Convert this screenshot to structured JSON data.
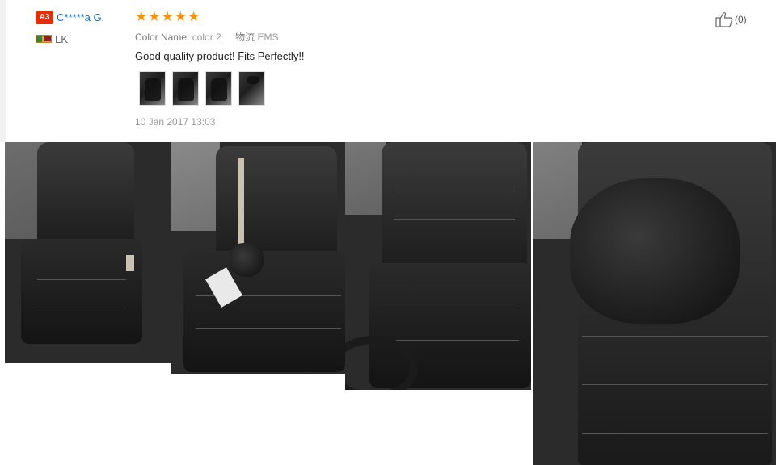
{
  "reviewer": {
    "level_badge": "A3",
    "name": "C*****a G.",
    "country_code": "LK"
  },
  "rating": {
    "stars": 5,
    "star_glyph": "★"
  },
  "attributes": {
    "color_label": "Color Name:",
    "color_value": "color 2",
    "logistics_label": "物流",
    "logistics_value": "EMS"
  },
  "review": {
    "text": "Good quality product! Fits Perfectly!!",
    "date": "10 Jan 2017 13:03"
  },
  "helpful": {
    "icon": "thumbs-up-icon",
    "count_text": "(0)"
  },
  "thumbnails": [
    "seat-photo-1",
    "seat-photo-2",
    "seat-photo-3",
    "seat-photo-4"
  ],
  "photos": [
    "front-seat-photo",
    "rear-seat-pillow-photo",
    "driver-seat-photo",
    "headrest-pillow-photo"
  ],
  "colors": {
    "accent_star": "#ff9000",
    "buyer_link": "#1a6ebd",
    "badge": "#e62e04"
  }
}
